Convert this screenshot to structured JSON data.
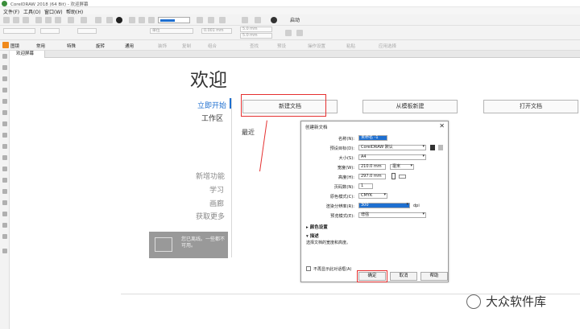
{
  "titlebar": {
    "title": "CorelDRAW 2018 (64 Bit) - 欢迎屏幕"
  },
  "menubar": {
    "items": [
      "文件(F)",
      "工具(O)",
      "窗口(W)",
      "帮助(H)"
    ]
  },
  "stdbar": {
    "launch_label": "启动"
  },
  "propbar": {
    "field1": "单位",
    "field2": "0.001 mm",
    "field3a": "5.0 mm",
    "field3b": "5.0 mm"
  },
  "workbar": {
    "items": [
      "图镜",
      "常用",
      "特殊",
      "旋转",
      "通用",
      "装饰",
      "复制",
      "组合",
      "查找",
      "预设",
      "操作设置",
      "粘贴",
      "应用选择"
    ]
  },
  "tabbar": {
    "tab_label": "欢迎屏幕"
  },
  "welcome": {
    "title": "欢迎",
    "nav": {
      "start": "立即开始",
      "workspace": "工作区",
      "whats_new": "新增功能",
      "learn": "学习",
      "gallery": "画廊",
      "get_more": "获取更多"
    },
    "buttons": {
      "new_doc": "新建文档",
      "from_template": "从模板新建",
      "open_doc": "打开文档"
    },
    "recent": "最近",
    "tip": "您已离线。一些都不可用。"
  },
  "dialog": {
    "title": "创建新文档",
    "fields": {
      "name_label": "名称(N):",
      "name_value": "未命名 -1",
      "preset_label": "预设目标(D):",
      "preset_value": "CorelDRAW 默认",
      "size_label": "大小(S):",
      "size_value": "A4",
      "width_label": "宽度(W):",
      "width_value": "210.0 mm",
      "unit_value": "毫米",
      "height_label": "高度(H):",
      "height_value": "297.0 mm",
      "pages_label": "页码数(N):",
      "pages_value": "1",
      "color_mode_label": "原色模式(C):",
      "color_mode_value": "CMYK",
      "resolution_label": "渲染分辨率(R):",
      "resolution_value": "300",
      "resolution_unit": "dpi",
      "preview_label": "预览模式(E):",
      "preview_value": "增强"
    },
    "section_color": "颜色设置",
    "section_desc": "描述",
    "description": "选择文档的宽度和高度。",
    "dont_show": "不再显示此对话框(A)",
    "ok": "确定",
    "cancel": "取消",
    "help": "帮助"
  },
  "watermark": "大众软件库",
  "accent": "#1e6fd0",
  "annotation_red": "#e53030"
}
